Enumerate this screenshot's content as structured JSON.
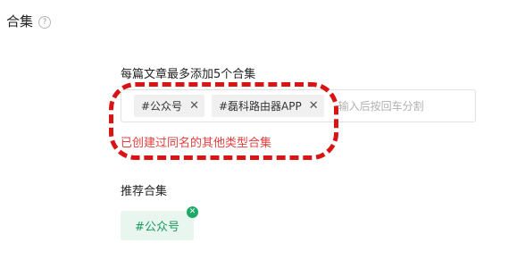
{
  "section": {
    "title": "合集",
    "help_icon": "question-circle-icon"
  },
  "collection_field": {
    "label": "每篇文章最多添加5个合集",
    "tags": [
      {
        "label": "#公众号",
        "close_icon": "close-icon"
      },
      {
        "label": "#磊科路由器APP",
        "close_icon": "close-icon"
      }
    ],
    "input_placeholder": "输入后按回车分割",
    "error_message": "已创建过同名的其他类型合集"
  },
  "recommended": {
    "label": "推荐合集",
    "tags": [
      {
        "label": "#公众号",
        "badge_icon": "close-circle-icon"
      }
    ]
  },
  "colors": {
    "error": "#e33e3e",
    "annotation": "#d91414",
    "recommend_text": "#1d9a5e",
    "recommend_bg": "#e8f6ef",
    "badge": "#1eaa66"
  }
}
